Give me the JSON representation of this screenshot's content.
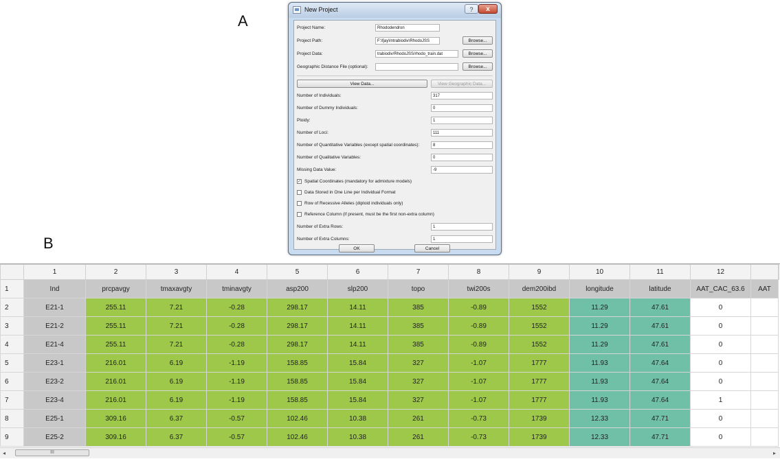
{
  "panel_labels": {
    "a": "A",
    "b": "B"
  },
  "dialog": {
    "title": "New Project",
    "help_label": "?",
    "close_label": "x",
    "fields": [
      {
        "label": "Project Name:",
        "value": "Rhododendron",
        "browse": ""
      },
      {
        "label": "Project Path:",
        "value": "F:\\fjay\\Intrabiodiv\\RhodoJSS",
        "browse": "Browse..."
      },
      {
        "label": "Project Data:",
        "value": "trabiodiv/RhodoJSS/rhodo_train.dat",
        "browse": "Browse..."
      },
      {
        "label": "Geographic Distance File (optional):",
        "value": "",
        "browse": "Browse..."
      }
    ],
    "view_data_label": "View Data...",
    "view_geo_label": "View Geographic Data...",
    "params": [
      {
        "label": "Number of Individuals:",
        "value": "317"
      },
      {
        "label": "Number of Dummy Individuals:",
        "value": "0"
      },
      {
        "label": "Ploidy:",
        "value": "1"
      },
      {
        "label": "Number of Loci:",
        "value": "111"
      },
      {
        "label": "Number of Quantitative Variables (except spatial coordinates):",
        "value": "8"
      },
      {
        "label": "Number of Qualitative Variables:",
        "value": "0"
      },
      {
        "label": "Missing Data Value:",
        "value": "-9"
      }
    ],
    "checkboxes": [
      {
        "label": "Spatial Coordinates (mandatory for admixture models)",
        "checked": true
      },
      {
        "label": "Data Stored in One Line per Individual Format",
        "checked": false
      },
      {
        "label": "Row of Recessive Alleles (diploid individuals only)",
        "checked": false
      },
      {
        "label": "Reference Column (if present, must be the first non-extra column)",
        "checked": false
      }
    ],
    "extras": [
      {
        "label": "Number of Extra Rows:",
        "value": "1"
      },
      {
        "label": "Number of Extra Columns:",
        "value": "1"
      }
    ],
    "ok_label": "OK",
    "cancel_label": "Cancel"
  },
  "table": {
    "column_numbers": [
      "1",
      "2",
      "3",
      "4",
      "5",
      "6",
      "7",
      "8",
      "9",
      "10",
      "11",
      "12",
      ""
    ],
    "row_numbers": [
      "1",
      "2",
      "3",
      "4",
      "5",
      "6",
      "7",
      "8",
      "9"
    ],
    "header_row": [
      "Ind",
      "prcpavgy",
      "tmaxavgty",
      "tminavgty",
      "asp200",
      "slp200",
      "topo",
      "twi200s",
      "dem200ibd",
      "longitude",
      "latitude",
      "AAT_CAC_63.6",
      "AAT"
    ],
    "data_rows": [
      [
        "E21-1",
        "255.11",
        "7.21",
        "-0.28",
        "298.17",
        "14.11",
        "385",
        "-0.89",
        "1552",
        "11.29",
        "47.61",
        "0",
        ""
      ],
      [
        "E21-2",
        "255.11",
        "7.21",
        "-0.28",
        "298.17",
        "14.11",
        "385",
        "-0.89",
        "1552",
        "11.29",
        "47.61",
        "0",
        ""
      ],
      [
        "E21-4",
        "255.11",
        "7.21",
        "-0.28",
        "298.17",
        "14.11",
        "385",
        "-0.89",
        "1552",
        "11.29",
        "47.61",
        "0",
        ""
      ],
      [
        "E23-1",
        "216.01",
        "6.19",
        "-1.19",
        "158.85",
        "15.84",
        "327",
        "-1.07",
        "1777",
        "11.93",
        "47.64",
        "0",
        ""
      ],
      [
        "E23-2",
        "216.01",
        "6.19",
        "-1.19",
        "158.85",
        "15.84",
        "327",
        "-1.07",
        "1777",
        "11.93",
        "47.64",
        "0",
        ""
      ],
      [
        "E23-4",
        "216.01",
        "6.19",
        "-1.19",
        "158.85",
        "15.84",
        "327",
        "-1.07",
        "1777",
        "11.93",
        "47.64",
        "1",
        ""
      ],
      [
        "E25-1",
        "309.16",
        "6.37",
        "-0.57",
        "102.46",
        "10.38",
        "261",
        "-0.73",
        "1739",
        "12.33",
        "47.71",
        "0",
        ""
      ],
      [
        "E25-2",
        "309.16",
        "6.37",
        "-0.57",
        "102.46",
        "10.38",
        "261",
        "-0.73",
        "1739",
        "12.33",
        "47.71",
        "0",
        ""
      ]
    ],
    "column_colors": [
      "gray",
      "green",
      "green",
      "green",
      "green",
      "green",
      "green",
      "green",
      "green",
      "teal",
      "teal",
      "white",
      "white"
    ],
    "colors": {
      "gray": "#c8c8c8",
      "green": "#9ec84a",
      "teal": "#6fc0a6",
      "white": "#ffffff"
    }
  },
  "scrollbar": {
    "left_arrow": "◂",
    "thumb_grip": "III",
    "right_arrow": "▸"
  }
}
